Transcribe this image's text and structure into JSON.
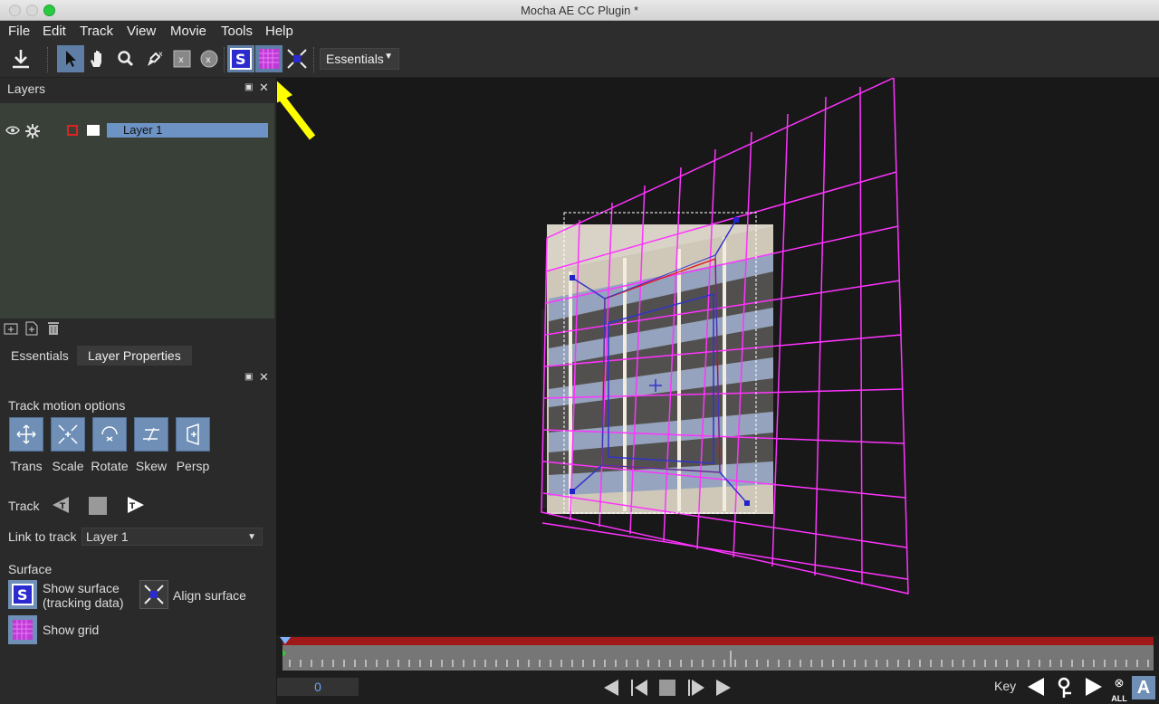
{
  "window": {
    "title": "Mocha AE CC Plugin *"
  },
  "menu": [
    "File",
    "Edit",
    "Track",
    "View",
    "Movie",
    "Tools",
    "Help"
  ],
  "toolbar": {
    "workspace": "Essentials"
  },
  "layers_panel": {
    "title": "Layers",
    "layer_name": "Layer 1"
  },
  "params_panel": {
    "tabs": [
      "Essentials",
      "Layer Properties"
    ],
    "track_motion_title": "Track motion options",
    "motion_options": [
      "Trans",
      "Scale",
      "Rotate",
      "Skew",
      "Persp"
    ],
    "track_label": "Track",
    "link_label": "Link to track",
    "link_value": "Layer 1",
    "surface_title": "Surface",
    "show_surface": "Show surface",
    "show_surface_sub": "(tracking data)",
    "align_surface": "Align surface",
    "show_grid": "Show grid"
  },
  "timeline": {
    "frame": "0",
    "key_label": "Key",
    "all_label": "ALL"
  },
  "colors": {
    "grid": "#ff33ff",
    "surface": "#3333cc",
    "accent": "#6f8fb6",
    "annotation_arrow": "#ffff00"
  }
}
